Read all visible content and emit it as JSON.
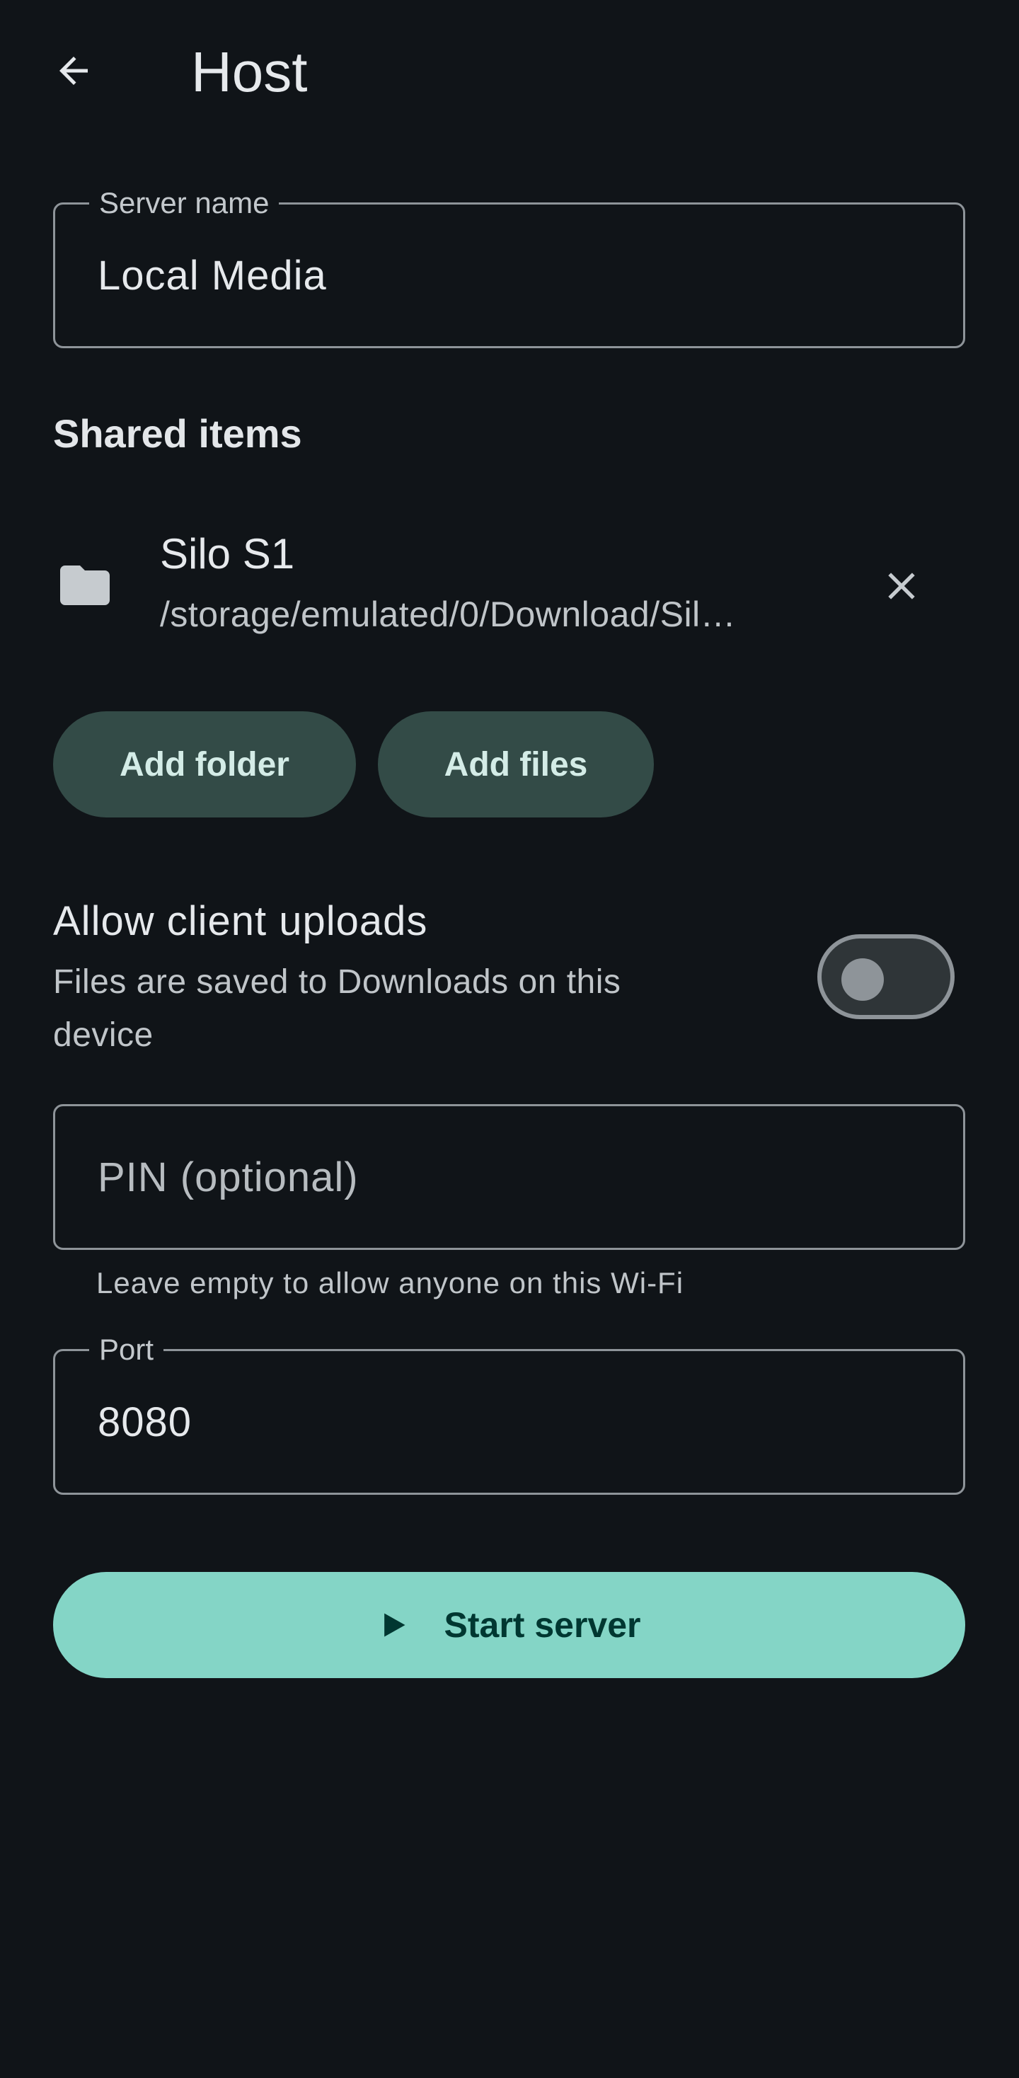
{
  "app_bar": {
    "title": "Host",
    "back_icon": "arrow-back-icon"
  },
  "server_name": {
    "label": "Server name",
    "value": "Local Media"
  },
  "shared_items": {
    "title": "Shared items",
    "items": [
      {
        "icon": "folder-icon",
        "name": "Silo S1",
        "path": "/storage/emulated/0/Download/Sil…",
        "remove_icon": "close-icon"
      }
    ],
    "add_folder_label": "Add folder",
    "add_files_label": "Add files"
  },
  "uploads": {
    "title": "Allow client uploads",
    "description": "Files are saved to Downloads on this device",
    "enabled": false
  },
  "pin": {
    "placeholder": "PIN (optional)",
    "value": "",
    "helper": "Leave empty to allow anyone on this Wi-Fi"
  },
  "port": {
    "label": "Port",
    "value": "8080"
  },
  "start_button": {
    "label": "Start server",
    "icon": "play-icon"
  },
  "colors": {
    "background": "#101418",
    "primary": "#84d5c6",
    "tonal_button": "#334b47",
    "outline": "#8e9499"
  }
}
